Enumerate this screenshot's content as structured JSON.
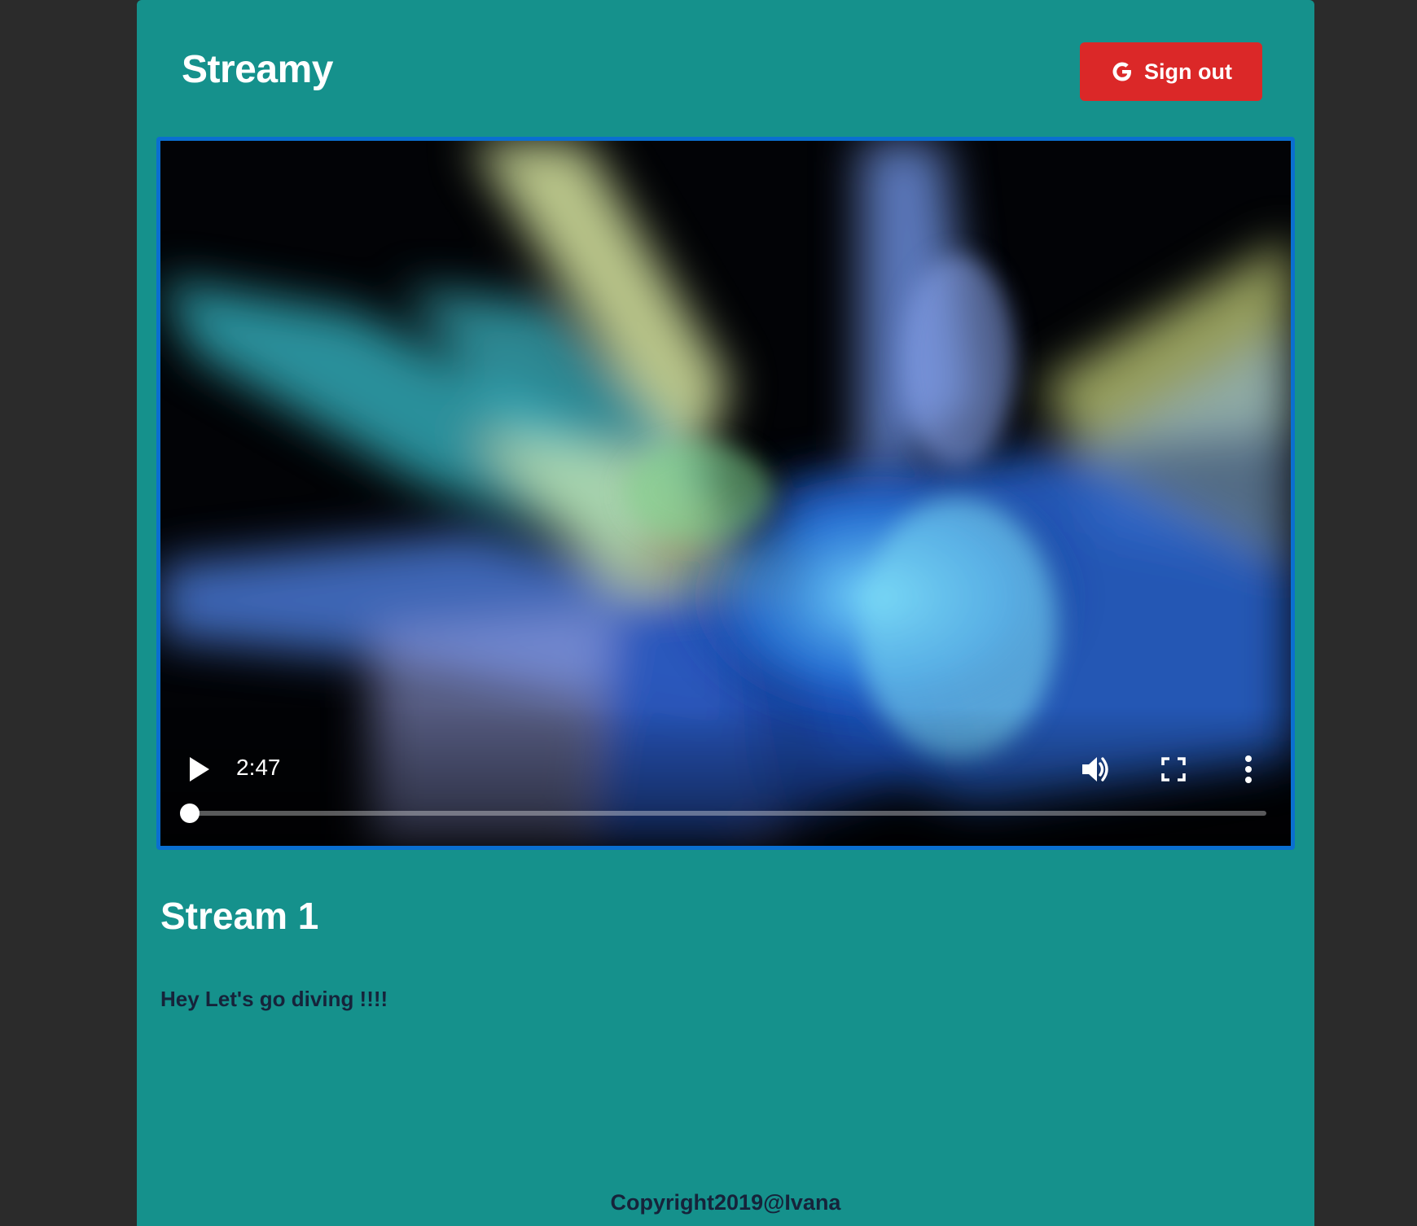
{
  "header": {
    "brand": "Streamy",
    "signout_label": "Sign out",
    "signout_icon": "google-icon"
  },
  "player": {
    "time": "2:47",
    "progress": 0.0,
    "icons": {
      "play": "play-icon",
      "volume": "volume-icon",
      "fullscreen": "fullscreen-icon",
      "more": "more-vertical-icon"
    }
  },
  "stream": {
    "title": "Stream 1",
    "description": "Hey Let's go diving !!!!"
  },
  "footer": {
    "text": "Copyright2019@Ivana"
  },
  "colors": {
    "page_bg": "#15918c",
    "outer_bg": "#2b2b2b",
    "signout_bg": "#db2828",
    "player_border": "#0a6fd0",
    "dark_text": "#16233a"
  }
}
